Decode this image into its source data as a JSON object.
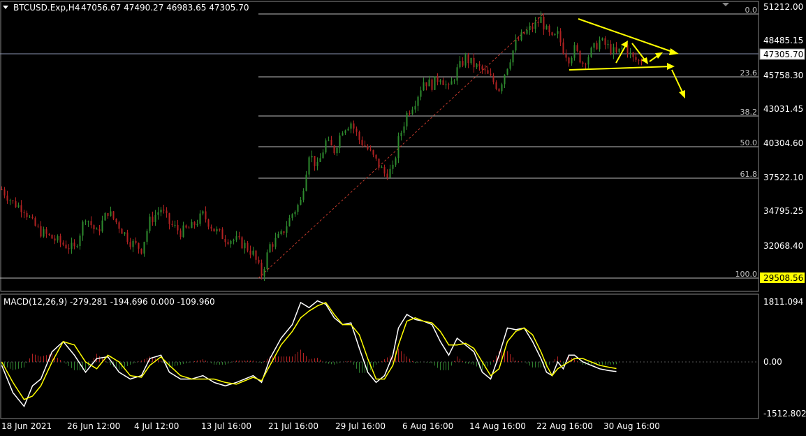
{
  "header": {
    "symbol_label": "BTCUSD.Exp,H4",
    "ohlc_text": "47056.67 47490.27 46983.65 47305.70"
  },
  "price_axis": {
    "ticks": [
      "51212.00",
      "48485.15",
      "45758.30",
      "43031.45",
      "40304.60",
      "37522.10",
      "34795.25",
      "32068.40"
    ],
    "current_price": "47305.70",
    "low_marker": "29508.56"
  },
  "fibonacci": {
    "levels": [
      "0.0",
      "23.6",
      "38.2",
      "50.0",
      "61.8",
      "100.0"
    ],
    "color": "#c0c0c0"
  },
  "macd": {
    "label": "MACD(12,26,9) -279.281 -194.696 0.000 -109.960",
    "axis_ticks": [
      "1811.094",
      "0.00",
      "-1512.802"
    ]
  },
  "time_axis": {
    "labels": [
      "18 Jun 2021",
      "26 Jun 12:00",
      "4 Jul 12:00",
      "13 Jul 16:00",
      "21 Jul 16:00",
      "29 Jul 16:00",
      "6 Aug 16:00",
      "14 Aug 16:00",
      "22 Aug 16:00",
      "30 Aug 16:00"
    ]
  },
  "colors": {
    "background": "#000000",
    "bull_candle": "#2e8b2e",
    "bear_candle": "#b22222",
    "annotation": "#ffff00",
    "macd_line": "#ffffff",
    "signal_line": "#ffff00",
    "hist_pos": "#b22222",
    "hist_neg": "#2e7d2e"
  },
  "chart_data": {
    "type": "candlestick",
    "symbol": "BTCUSD.Exp",
    "timeframe": "H4",
    "ylim": [
      29000,
      51500
    ],
    "price_path": [
      [
        0,
        36800
      ],
      [
        4,
        35700
      ],
      [
        8,
        35200
      ],
      [
        11,
        34000
      ],
      [
        14,
        33300
      ],
      [
        18,
        32800
      ],
      [
        22,
        32300
      ],
      [
        26,
        31900
      ],
      [
        30,
        34600
      ],
      [
        34,
        33200
      ],
      [
        38,
        35000
      ],
      [
        42,
        33800
      ],
      [
        46,
        32500
      ],
      [
        50,
        31900
      ],
      [
        53,
        34200
      ],
      [
        57,
        35200
      ],
      [
        60,
        34000
      ],
      [
        64,
        33300
      ],
      [
        68,
        33700
      ],
      [
        72,
        34700
      ],
      [
        76,
        33500
      ],
      [
        80,
        32800
      ],
      [
        84,
        32600
      ],
      [
        87,
        32200
      ],
      [
        90,
        31500
      ],
      [
        93,
        29800
      ],
      [
        96,
        32200
      ],
      [
        100,
        33000
      ],
      [
        104,
        34800
      ],
      [
        107,
        35800
      ],
      [
        110,
        39800
      ],
      [
        113,
        38600
      ],
      [
        116,
        40700
      ],
      [
        119,
        40000
      ],
      [
        122,
        41800
      ],
      [
        125,
        42300
      ],
      [
        128,
        40900
      ],
      [
        131,
        40100
      ],
      [
        134,
        39100
      ],
      [
        137,
        38100
      ],
      [
        140,
        38400
      ],
      [
        142,
        40800
      ],
      [
        145,
        43000
      ],
      [
        148,
        44100
      ],
      [
        151,
        45700
      ],
      [
        154,
        45400
      ],
      [
        157,
        46100
      ],
      [
        160,
        45000
      ],
      [
        163,
        46600
      ],
      [
        166,
        47600
      ],
      [
        169,
        47000
      ],
      [
        172,
        46600
      ],
      [
        175,
        45900
      ],
      [
        178,
        45100
      ],
      [
        181,
        47000
      ],
      [
        184,
        48800
      ],
      [
        187,
        49600
      ],
      [
        190,
        50100
      ],
      [
        193,
        50800
      ],
      [
        195,
        49800
      ],
      [
        197,
        49100
      ],
      [
        199,
        49500
      ],
      [
        201,
        48300
      ],
      [
        203,
        47600
      ],
      [
        205,
        48300
      ],
      [
        208,
        47200
      ],
      [
        211,
        48100
      ],
      [
        214,
        49000
      ],
      [
        217,
        48500
      ],
      [
        220,
        47900
      ],
      [
        223,
        48600
      ],
      [
        226,
        47500
      ],
      [
        229,
        47300
      ]
    ],
    "last_close": 47305.7,
    "swing_low": 29508.56,
    "swing_high": 51212.0,
    "fib_retracement": [
      {
        "level": "0.0",
        "price": 51212.0
      },
      {
        "level": "23.6",
        "price": 46090
      },
      {
        "level": "38.2",
        "price": 42920
      },
      {
        "level": "50.0",
        "price": 40360
      },
      {
        "level": "61.8",
        "price": 37800
      },
      {
        "level": "100.0",
        "price": 29508.56
      }
    ],
    "macd": {
      "params": "12,26,9",
      "ylim": [
        -1512.802,
        1811.094
      ],
      "values": [
        -279.281,
        -194.696,
        0.0,
        -109.96
      ],
      "main": [
        [
          0,
          -100
        ],
        [
          4,
          -900
        ],
        [
          8,
          -1300
        ],
        [
          11,
          -700
        ],
        [
          14,
          -500
        ],
        [
          18,
          300
        ],
        [
          22,
          600
        ],
        [
          26,
          200
        ],
        [
          30,
          -300
        ],
        [
          34,
          100
        ],
        [
          38,
          150
        ],
        [
          42,
          -300
        ],
        [
          46,
          -500
        ],
        [
          50,
          -400
        ],
        [
          53,
          100
        ],
        [
          57,
          200
        ],
        [
          60,
          -300
        ],
        [
          64,
          -500
        ],
        [
          68,
          -500
        ],
        [
          72,
          -400
        ],
        [
          76,
          -600
        ],
        [
          80,
          -700
        ],
        [
          84,
          -600
        ],
        [
          87,
          -500
        ],
        [
          90,
          -400
        ],
        [
          93,
          -600
        ],
        [
          96,
          100
        ],
        [
          100,
          700
        ],
        [
          104,
          1100
        ],
        [
          107,
          1750
        ],
        [
          110,
          1600
        ],
        [
          113,
          1800
        ],
        [
          116,
          1700
        ],
        [
          119,
          1300
        ],
        [
          122,
          1100
        ],
        [
          125,
          1150
        ],
        [
          128,
          400
        ],
        [
          131,
          -300
        ],
        [
          134,
          -600
        ],
        [
          137,
          -400
        ],
        [
          140,
          200
        ],
        [
          142,
          1000
        ],
        [
          145,
          1400
        ],
        [
          148,
          1250
        ],
        [
          151,
          1200
        ],
        [
          154,
          1100
        ],
        [
          157,
          600
        ],
        [
          160,
          200
        ],
        [
          163,
          700
        ],
        [
          166,
          500
        ],
        [
          169,
          300
        ],
        [
          172,
          -300
        ],
        [
          175,
          -500
        ],
        [
          178,
          200
        ],
        [
          181,
          1000
        ],
        [
          184,
          950
        ],
        [
          187,
          1000
        ],
        [
          190,
          600
        ],
        [
          193,
          100
        ],
        [
          195,
          -300
        ],
        [
          197,
          -400
        ],
        [
          199,
          0
        ],
        [
          201,
          -200
        ],
        [
          203,
          200
        ],
        [
          205,
          200
        ],
        [
          208,
          0
        ],
        [
          211,
          -100
        ],
        [
          214,
          -200
        ],
        [
          217,
          -250
        ],
        [
          220,
          -279
        ]
      ],
      "signal": [
        [
          0,
          0
        ],
        [
          4,
          -600
        ],
        [
          8,
          -1100
        ],
        [
          11,
          -1000
        ],
        [
          14,
          -700
        ],
        [
          18,
          0
        ],
        [
          22,
          600
        ],
        [
          26,
          500
        ],
        [
          30,
          0
        ],
        [
          34,
          -200
        ],
        [
          38,
          200
        ],
        [
          42,
          0
        ],
        [
          46,
          -400
        ],
        [
          50,
          -450
        ],
        [
          53,
          -100
        ],
        [
          57,
          150
        ],
        [
          60,
          -100
        ],
        [
          64,
          -400
        ],
        [
          68,
          -500
        ],
        [
          72,
          -500
        ],
        [
          76,
          -500
        ],
        [
          80,
          -600
        ],
        [
          84,
          -650
        ],
        [
          87,
          -550
        ],
        [
          90,
          -450
        ],
        [
          93,
          -550
        ],
        [
          96,
          -100
        ],
        [
          100,
          500
        ],
        [
          104,
          900
        ],
        [
          107,
          1300
        ],
        [
          110,
          1500
        ],
        [
          113,
          1650
        ],
        [
          116,
          1750
        ],
        [
          119,
          1400
        ],
        [
          122,
          1100
        ],
        [
          125,
          1100
        ],
        [
          128,
          800
        ],
        [
          131,
          100
        ],
        [
          134,
          -500
        ],
        [
          137,
          -500
        ],
        [
          140,
          -100
        ],
        [
          142,
          500
        ],
        [
          145,
          1200
        ],
        [
          148,
          1300
        ],
        [
          151,
          1200
        ],
        [
          154,
          1150
        ],
        [
          157,
          900
        ],
        [
          160,
          500
        ],
        [
          163,
          500
        ],
        [
          166,
          550
        ],
        [
          169,
          400
        ],
        [
          172,
          0
        ],
        [
          175,
          -400
        ],
        [
          178,
          -200
        ],
        [
          181,
          600
        ],
        [
          184,
          900
        ],
        [
          187,
          1000
        ],
        [
          190,
          800
        ],
        [
          193,
          300
        ],
        [
          195,
          -100
        ],
        [
          197,
          -400
        ],
        [
          199,
          -200
        ],
        [
          201,
          -100
        ],
        [
          203,
          0
        ],
        [
          205,
          100
        ],
        [
          208,
          100
        ],
        [
          211,
          0
        ],
        [
          214,
          -100
        ],
        [
          217,
          -150
        ],
        [
          220,
          -195
        ]
      ]
    }
  }
}
